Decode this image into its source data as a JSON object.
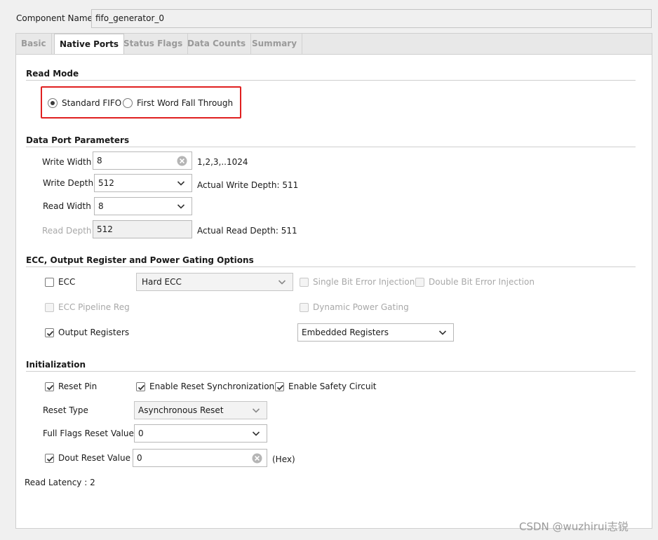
{
  "component": {
    "label": "Component Name",
    "value": "fifo_generator_0"
  },
  "tabs": [
    {
      "label": "Basic",
      "active": false
    },
    {
      "label": "Native Ports",
      "active": true
    },
    {
      "label": "Status Flags",
      "active": false
    },
    {
      "label": "Data Counts",
      "active": false
    },
    {
      "label": "Summary",
      "active": false
    }
  ],
  "read_mode": {
    "title": "Read Mode",
    "options": [
      "Standard FIFO",
      "First Word Fall Through"
    ],
    "selected": "Standard FIFO",
    "highlight_color": "#e02020"
  },
  "data_port": {
    "title": "Data Port Parameters",
    "write_width": {
      "label": "Write Width",
      "value": "8",
      "hint": "1,2,3,..1024"
    },
    "write_depth": {
      "label": "Write Depth",
      "value": "512",
      "hint": "Actual Write Depth: 511"
    },
    "read_width": {
      "label": "Read Width",
      "value": "8"
    },
    "read_depth": {
      "label": "Read Depth",
      "value": "512",
      "hint": "Actual Read Depth: 511"
    }
  },
  "ecc_section": {
    "title": "ECC, Output Register and Power Gating Options",
    "ecc": {
      "label": "ECC",
      "checked": false
    },
    "ecc_type": {
      "value": "Hard ECC"
    },
    "single_bit": {
      "label": "Single Bit Error Injection",
      "checked": false
    },
    "double_bit": {
      "label": "Double Bit Error Injection",
      "checked": false
    },
    "ecc_pipeline": {
      "label": "ECC Pipeline Reg",
      "checked": false
    },
    "dynamic_power": {
      "label": "Dynamic Power Gating",
      "checked": false
    },
    "output_registers": {
      "label": "Output Registers",
      "checked": true
    },
    "register_type": {
      "value": "Embedded Registers"
    }
  },
  "initialization": {
    "title": "Initialization",
    "reset_pin": {
      "label": "Reset Pin",
      "checked": true
    },
    "reset_sync": {
      "label": "Enable Reset Synchronization",
      "checked": true
    },
    "safety_circuit": {
      "label": "Enable Safety Circuit",
      "checked": true
    },
    "reset_type": {
      "label": "Reset Type",
      "value": "Asynchronous Reset"
    },
    "full_flags": {
      "label": "Full Flags Reset Value",
      "value": "0"
    },
    "dout_reset": {
      "label": "Dout Reset Value",
      "value": "0",
      "unit": "(Hex)",
      "checked": true
    }
  },
  "read_latency": "Read Latency : 2",
  "watermark": "CSDN @wuzhirui志锐"
}
